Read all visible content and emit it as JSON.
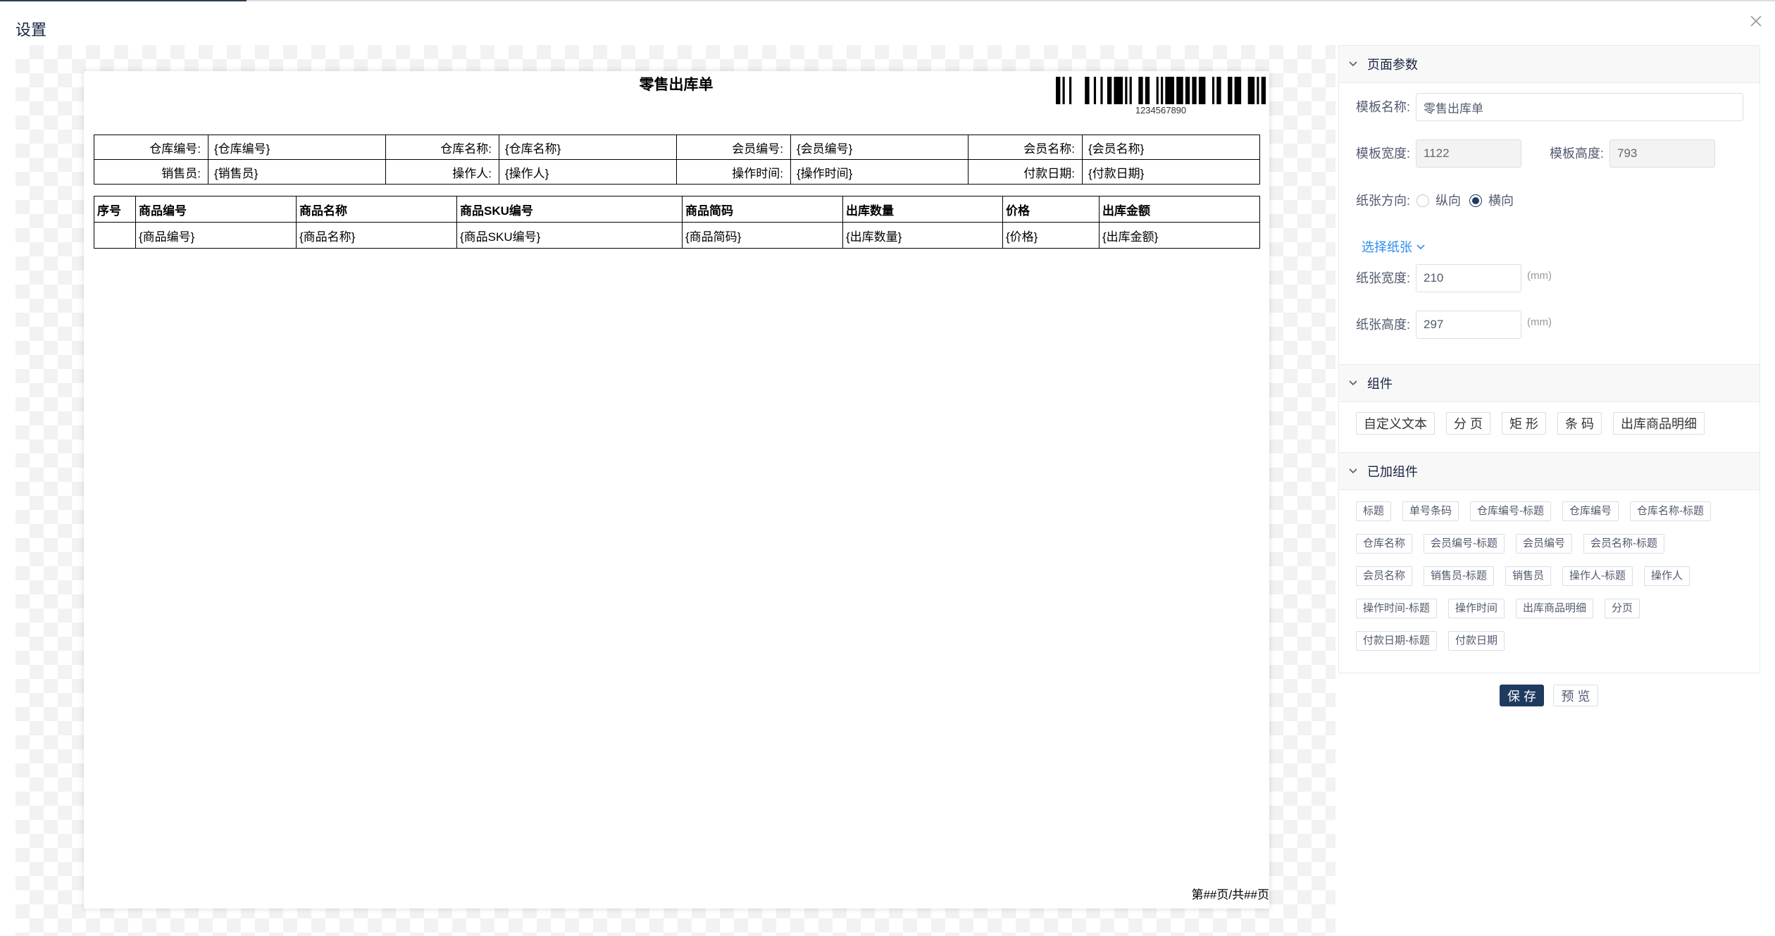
{
  "dialog": {
    "title": "设置"
  },
  "template": {
    "title": "零售出库单",
    "barcode_text": "1234567890",
    "header_rows": [
      [
        "仓库编号:",
        "{仓库编号}",
        "仓库名称:",
        "{仓库名称}",
        "会员编号:",
        "{会员编号}",
        "会员名称:",
        "{会员名称}"
      ],
      [
        "销售员:",
        "{销售员}",
        "操作人:",
        "{操作人}",
        "操作时间:",
        "{操作时间}",
        "付款日期:",
        "{付款日期}"
      ]
    ],
    "detail_columns": [
      "序号",
      "商品编号",
      "商品名称",
      "商品SKU编号",
      "商品简码",
      "出库数量",
      "价格",
      "出库金额"
    ],
    "detail_row": [
      "",
      "{商品编号}",
      "{商品名称}",
      "{商品SKU编号}",
      "{商品简码}",
      "{出库数量}",
      "{价格}",
      "{出库金额}"
    ],
    "page_footer": "第##页/共##页"
  },
  "panel": {
    "page_params": {
      "title": "页面参数",
      "template_name_label": "模板名称:",
      "template_name_value": "零售出库单",
      "template_width_label": "模板宽度:",
      "template_width_value": "1122",
      "template_height_label": "模板高度:",
      "template_height_value": "793",
      "orientation_label": "纸张方向:",
      "orientation_options": [
        {
          "label": "纵向",
          "checked": false
        },
        {
          "label": "横向",
          "checked": true
        }
      ],
      "select_paper_link": "选择纸张",
      "paper_width_label": "纸张宽度:",
      "paper_width_value": "210",
      "paper_height_label": "纸张高度:",
      "paper_height_value": "297",
      "unit": "(mm)"
    },
    "components": {
      "title": "组件",
      "buttons": [
        "自定义文本",
        "分 页",
        "矩 形",
        "条 码",
        "出库商品明细"
      ]
    },
    "added_components": {
      "title": "已加组件",
      "tags": [
        "标题",
        "单号条码",
        "仓库编号-标题",
        "仓库编号",
        "仓库名称-标题",
        "仓库名称",
        "会员编号-标题",
        "会员编号",
        "会员名称-标题",
        "会员名称",
        "销售员-标题",
        "销售员",
        "操作人-标题",
        "操作人",
        "操作时间-标题",
        "操作时间",
        "出库商品明细",
        "分页",
        "付款日期-标题",
        "付款日期"
      ]
    }
  },
  "actions": {
    "save_label": "保 存",
    "preview_label": "预 览"
  },
  "icons": {
    "close": "close-icon",
    "section_toggle": "chevron-down-icon",
    "select_paper_dropdown": "chevron-down-icon"
  },
  "colors": {
    "primary": "#1e3a5f",
    "link": "#2d8cf0",
    "border": "#dcdee2"
  }
}
